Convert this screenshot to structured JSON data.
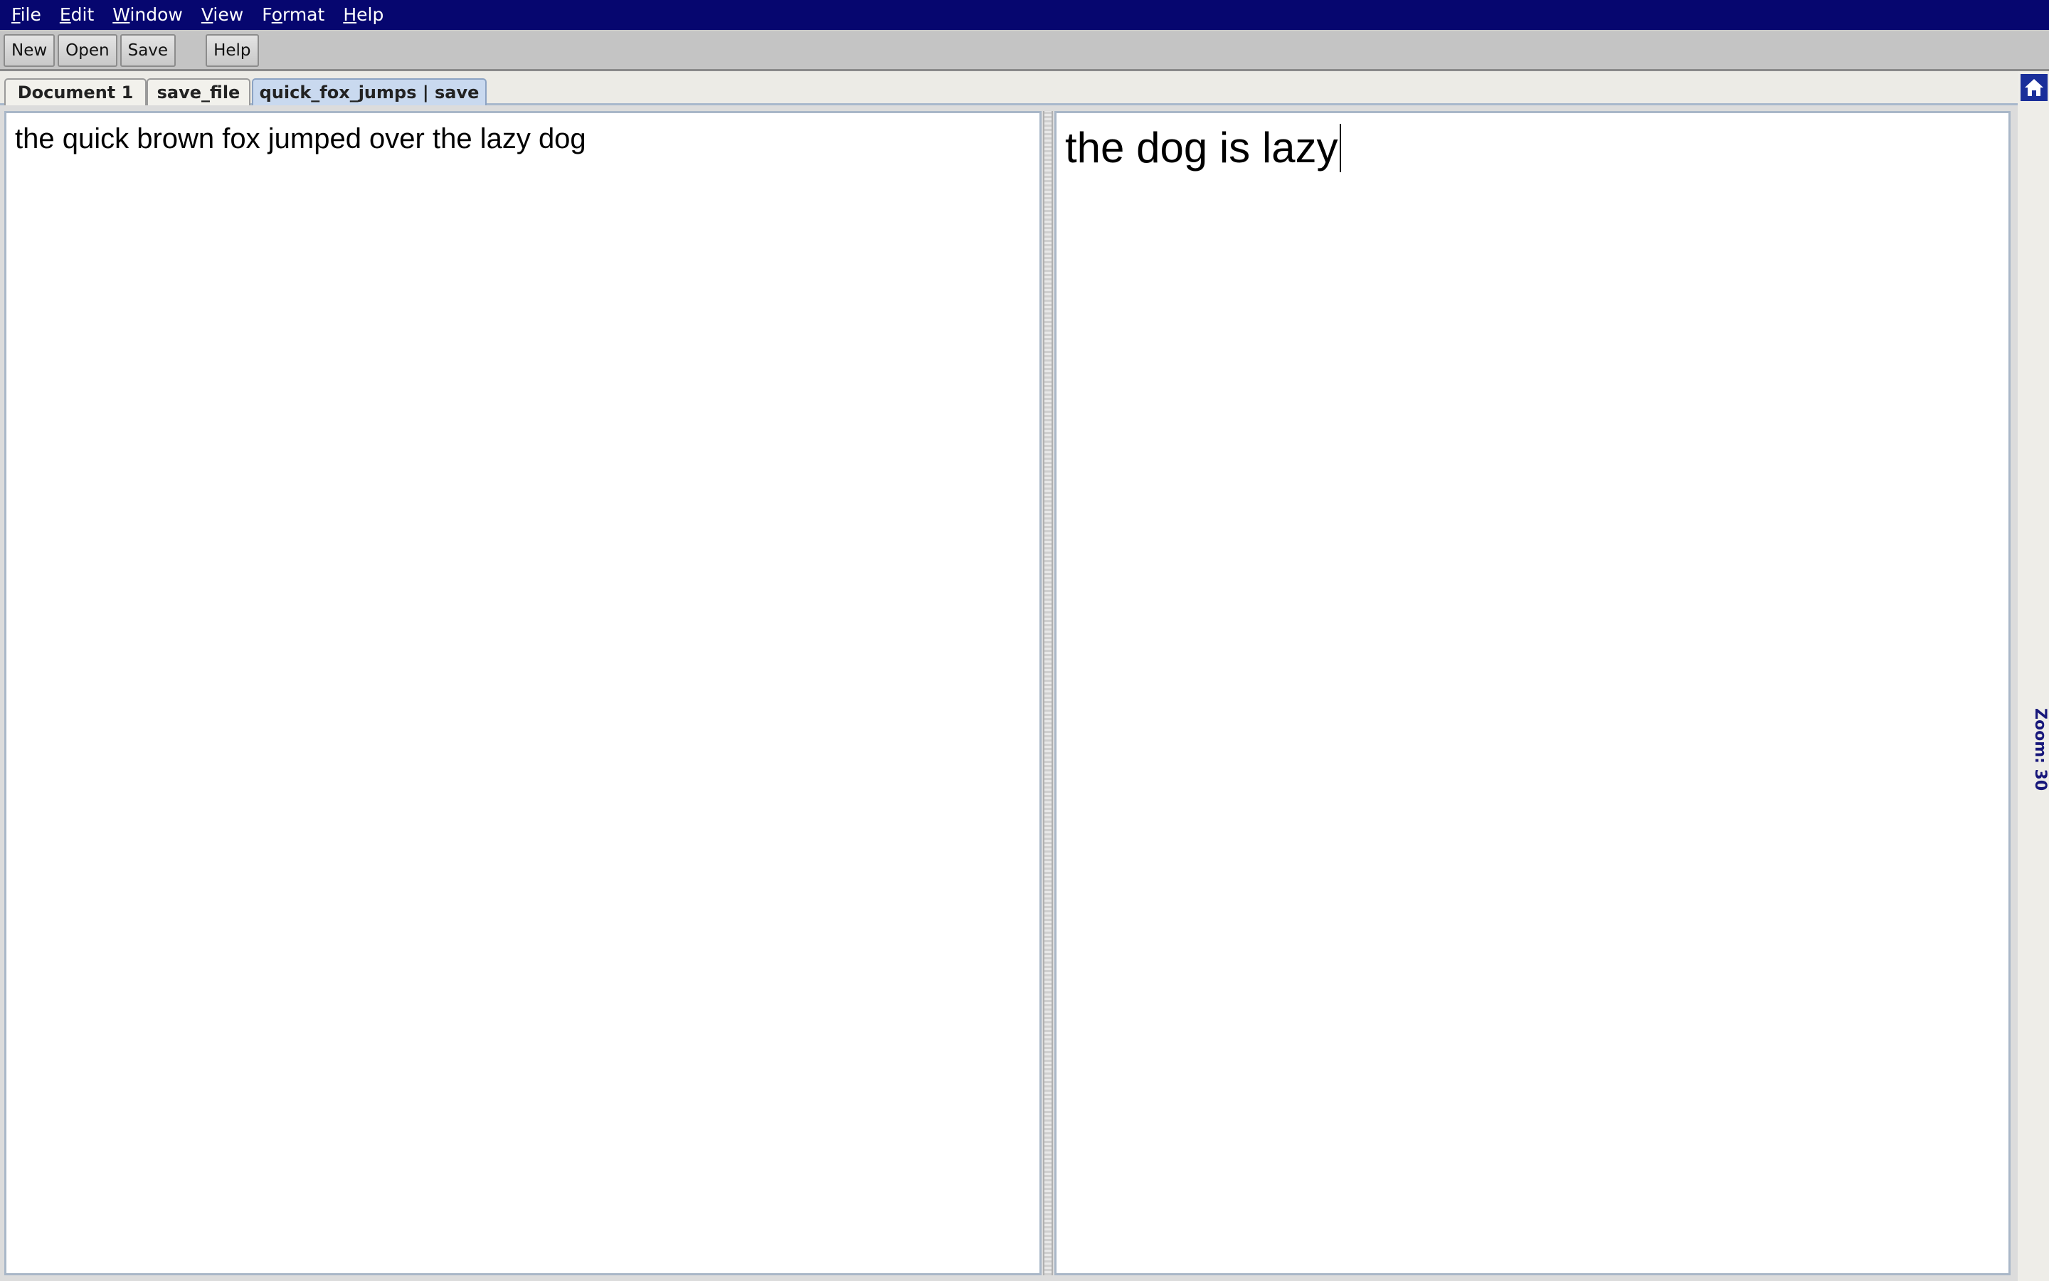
{
  "menubar": {
    "items": [
      {
        "mnemonic": "F",
        "rest": "ile"
      },
      {
        "mnemonic": "E",
        "rest": "dit"
      },
      {
        "mnemonic": "W",
        "rest": "indow"
      },
      {
        "mnemonic": "V",
        "rest": "iew"
      },
      {
        "prefix": "F",
        "mnemonic": "o",
        "rest": "rmat"
      },
      {
        "mnemonic": "H",
        "rest": "elp"
      }
    ]
  },
  "toolbar": {
    "new_label": "New",
    "open_label": "Open",
    "save_label": "Save",
    "help_label": "Help"
  },
  "tabs": [
    {
      "label": "Document 1",
      "active": false
    },
    {
      "label": "save_file",
      "active": false
    },
    {
      "label": "quick_fox_jumps | save",
      "active": true
    }
  ],
  "editor": {
    "left_pane_text": "the quick brown fox jumped over the lazy dog",
    "right_pane_text": "the dog is lazy"
  },
  "sidebar": {
    "home_icon": "home-icon",
    "zoom_label": "Zoom: 30"
  },
  "colors": {
    "menubar_bg": "#06066f",
    "active_tab_bg": "#c9d9ef",
    "zoom_text": "#17177a"
  }
}
